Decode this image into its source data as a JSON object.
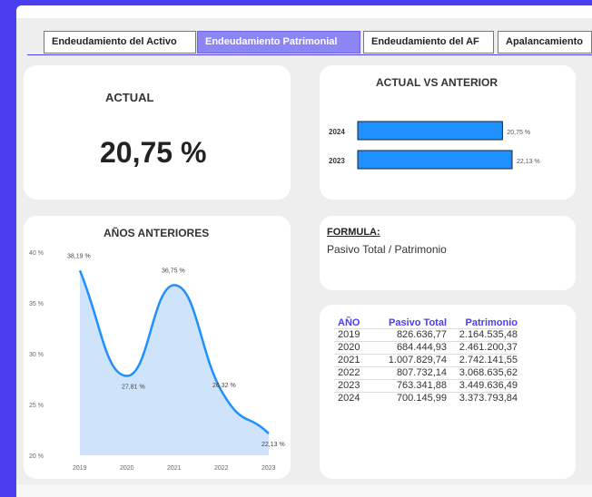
{
  "tabs": [
    {
      "label": "Endeudamiento del Activo",
      "active": false
    },
    {
      "label": "Endeudamiento Patrimonial",
      "active": true
    },
    {
      "label": "Endeudamiento del AF",
      "active": false
    },
    {
      "label": "Apalancamiento",
      "active": false
    }
  ],
  "actual": {
    "title": "ACTUAL",
    "value": "20,75 %"
  },
  "comparison": {
    "title": "ACTUAL VS ANTERIOR",
    "chart_data": {
      "type": "bar",
      "orientation": "horizontal",
      "categories": [
        "2024",
        "2023"
      ],
      "values": [
        20.75,
        22.13
      ],
      "value_labels": [
        "20,75 %",
        "22,13 %"
      ],
      "color": "#1e90ff"
    }
  },
  "history": {
    "title": "AÑOS ANTERIORES",
    "chart_data": {
      "type": "area",
      "x": [
        "2019",
        "2020",
        "2021",
        "2022",
        "2023"
      ],
      "values": [
        38.19,
        27.81,
        36.75,
        26.32,
        22.13
      ],
      "value_labels": [
        "38,19 %",
        "27,81 %",
        "36,75 %",
        "26,32 %",
        "22,13 %"
      ],
      "yticks": [
        "40 %",
        "35 %",
        "30 %",
        "25 %",
        "20 %"
      ],
      "ylim": [
        20,
        40
      ],
      "line_color": "#1e90ff",
      "fill_color": "#cfe3fb"
    }
  },
  "formula": {
    "title": "FORMULA:",
    "text": "Pasivo Total / Patrimonio"
  },
  "table": {
    "headers": [
      "AÑO",
      "Pasivo Total",
      "Patrimonio"
    ],
    "rows": [
      [
        "2019",
        "826.636,77",
        "2.164.535,48"
      ],
      [
        "2020",
        "684.444,93",
        "2.461.200,37"
      ],
      [
        "2021",
        "1.007.829,74",
        "2.742.141,55"
      ],
      [
        "2022",
        "807.732,14",
        "3.068.635,62"
      ],
      [
        "2023",
        "763.341,88",
        "3.449.636,49"
      ],
      [
        "2024",
        "700.145,99",
        "3.373.793,84"
      ]
    ],
    "header_color": "#4a3ef0"
  }
}
